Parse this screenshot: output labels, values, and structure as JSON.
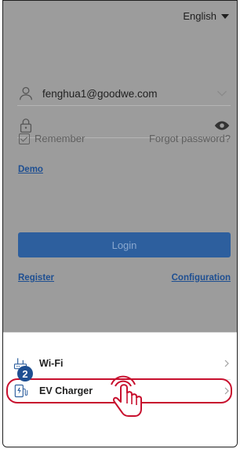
{
  "header": {
    "language": "English"
  },
  "login": {
    "username": "fenghua1@goodwe.com",
    "password": "",
    "remember_label": "Remember",
    "remember_checked": true,
    "forgot_password": "Forgot password?",
    "demo": "Demo",
    "login_button": "Login",
    "register": "Register",
    "configuration": "Configuration"
  },
  "sheet": {
    "items": [
      {
        "label": "Wi-Fi",
        "icon": "router-icon"
      },
      {
        "label": "EV Charger",
        "icon": "ev-charger-icon"
      }
    ]
  },
  "annotation": {
    "step_number": "2"
  },
  "colors": {
    "overlay": "#9c9c9c",
    "primary_button": "#2d5f9e",
    "link": "#1e4f92",
    "highlight": "#c8102e",
    "badge": "#1e4f92"
  }
}
